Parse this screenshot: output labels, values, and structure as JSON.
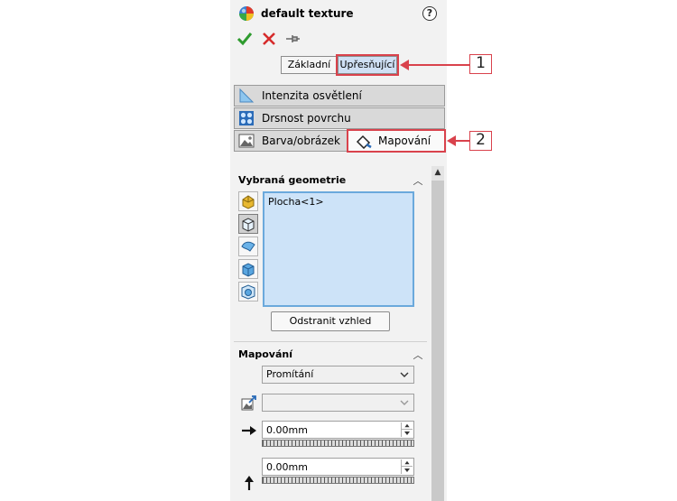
{
  "header": {
    "title": "default texture",
    "help": "?"
  },
  "tabs": {
    "basic": "Základní",
    "advanced": "Upřesňující"
  },
  "properties": {
    "lighting": "Intenzita osvětlení",
    "roughness": "Drsnost povrchu",
    "color": "Barva/obrázek",
    "mapping": "Mapování"
  },
  "selected_geometry": {
    "title": "Vybraná geometrie",
    "items": [
      "Plocha<1>"
    ],
    "remove_button": "Odstranit vzhled"
  },
  "mapping": {
    "title": "Mapování",
    "projection": "Promítání",
    "direction_value": "",
    "horizontal": "0.00mm",
    "vertical": "0.00mm"
  },
  "callouts": [
    "1",
    "2"
  ],
  "colors": {
    "highlight": "#d9424c",
    "selection": "#cde3f8",
    "ok": "#2e9b2e",
    "cancel": "#d62b2b"
  }
}
